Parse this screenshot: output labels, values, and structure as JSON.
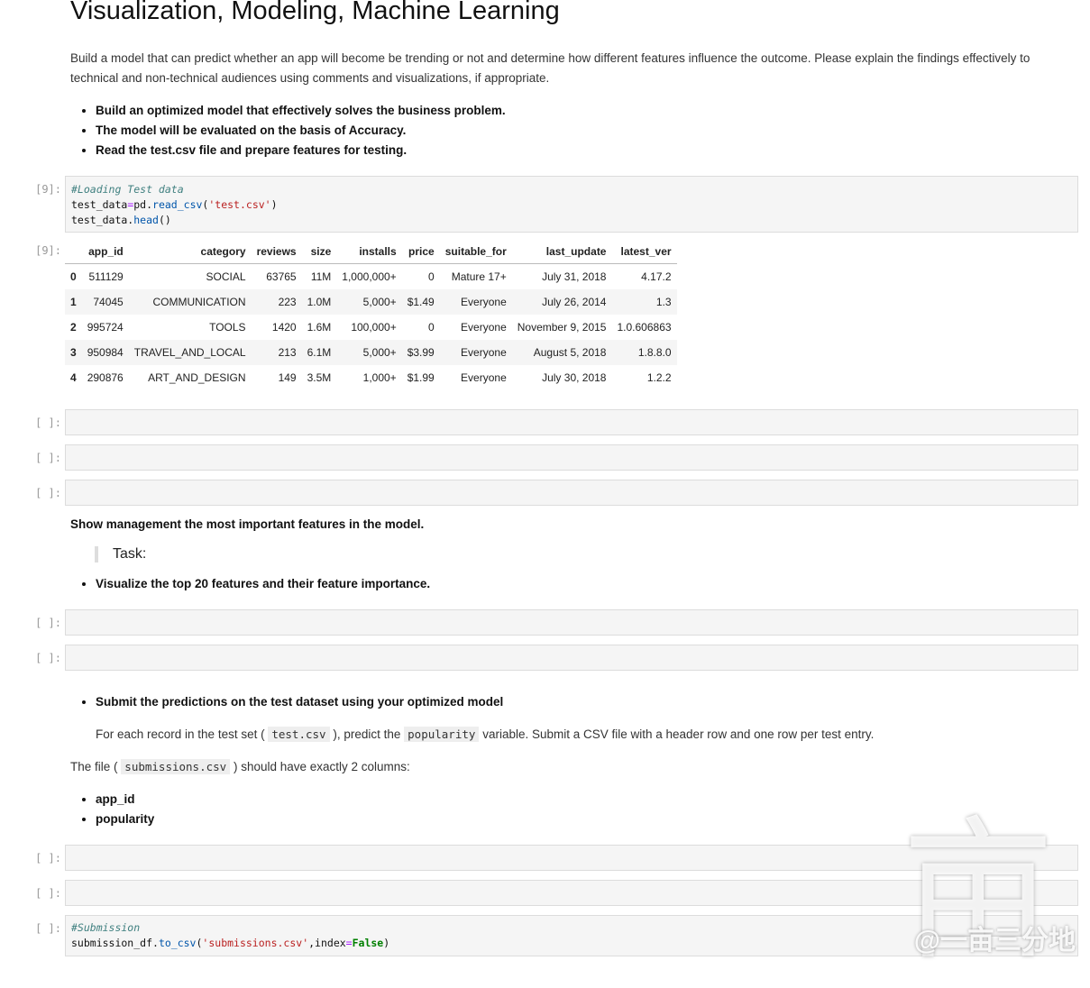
{
  "title": "Visualization, Modeling, Machine Learning",
  "intro": "Build a model that can predict whether an app will become be trending or not and determine how different features influence the outcome. Please explain the findings effectively to technical and non-technical audiences using comments and visualizations, if appropriate.",
  "goals": [
    "Build an optimized model that effectively solves the business problem.",
    "The model will be evaluated on the basis of Accuracy.",
    "Read the test.csv file and prepare features for testing."
  ],
  "cell9": {
    "prompt_in": "[9]:",
    "prompt_out": "[9]:",
    "comment": "#Loading Test data",
    "line2": {
      "a": "test_data",
      "eq": "=",
      "b": "pd.",
      "fn": "read_csv",
      "p1": "(",
      "str": "'test.csv'",
      "p2": ")"
    },
    "line3": {
      "a": "test_data.",
      "fn": "head",
      "p": "()"
    }
  },
  "table": {
    "columns": [
      "",
      "app_id",
      "category",
      "reviews",
      "size",
      "installs",
      "price",
      "suitable_for",
      "last_update",
      "latest_ver"
    ],
    "rows": [
      [
        "0",
        "511129",
        "SOCIAL",
        "63765",
        "11M",
        "1,000,000+",
        "0",
        "Mature 17+",
        "July 31, 2018",
        "4.17.2"
      ],
      [
        "1",
        "74045",
        "COMMUNICATION",
        "223",
        "1.0M",
        "5,000+",
        "$1.49",
        "Everyone",
        "July 26, 2014",
        "1.3"
      ],
      [
        "2",
        "995724",
        "TOOLS",
        "1420",
        "1.6M",
        "100,000+",
        "0",
        "Everyone",
        "November 9, 2015",
        "1.0.606863"
      ],
      [
        "3",
        "950984",
        "TRAVEL_AND_LOCAL",
        "213",
        "6.1M",
        "5,000+",
        "$3.99",
        "Everyone",
        "August 5, 2018",
        "1.8.8.0"
      ],
      [
        "4",
        "290876",
        "ART_AND_DESIGN",
        "149",
        "3.5M",
        "1,000+",
        "$1.99",
        "Everyone",
        "July 30, 2018",
        "1.2.2"
      ]
    ]
  },
  "empty_prompt": "[ ]:",
  "mgmt_heading": "Show management the most important features in the model.",
  "task_label": "Task:",
  "task_item": "Visualize the top 20 features and their feature importance.",
  "submit_item": "Submit the predictions on the test dataset using your optimized model",
  "submit_para": {
    "t1": "For each record in the test set (",
    "c1": "test.csv",
    "t2": "), predict the",
    "c2": "popularity",
    "t3": "variable. Submit a CSV file with a header row and one row per test entry."
  },
  "file_para": {
    "t1": "The file (",
    "c1": "submissions.csv",
    "t2": ") should have exactly 2 columns:"
  },
  "columns_list": [
    "app_id",
    "popularity"
  ],
  "submission_cell": {
    "comment": "#Submission",
    "a": "submission_df.",
    "fn": "to_csv",
    "p1": "(",
    "str": "'submissions.csv'",
    "b": ",index",
    "eq": "=",
    "kw": "False",
    "p2": ")"
  },
  "watermark": "@一亩三分地",
  "watermark_glyph": "亩"
}
